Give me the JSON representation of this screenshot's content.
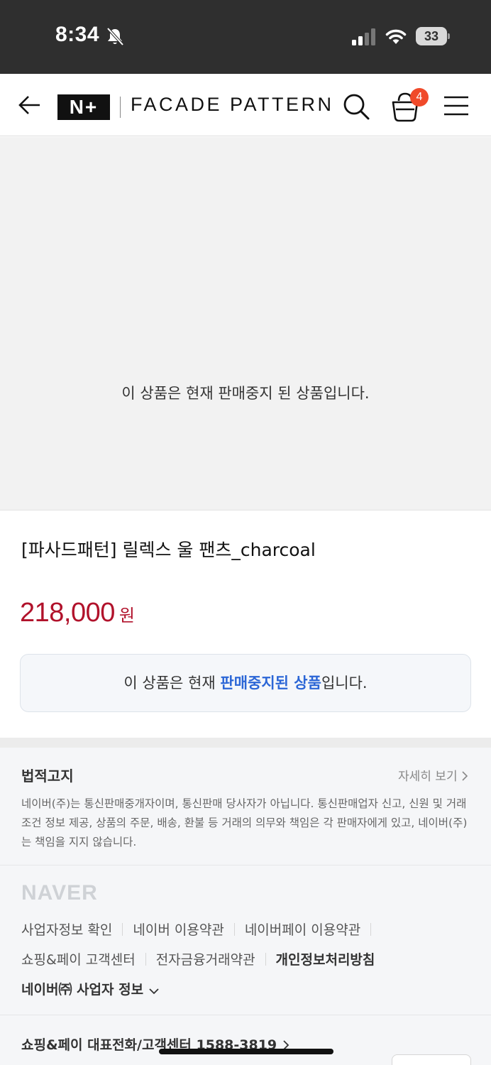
{
  "status_bar": {
    "time": "8:34",
    "battery": "33"
  },
  "header": {
    "logo_text": "N+",
    "brand": "FACADE PATTERN",
    "cart_count": "4"
  },
  "image_area": {
    "message": "이 상품은 현재 판매중지 된 상품입니다."
  },
  "product": {
    "title": "[파사드패턴] 릴렉스 울 팬츠_charcoal",
    "price": "218,000",
    "price_unit": "원",
    "status_prefix": "이 상품은 현재 ",
    "status_highlight": "판매중지된 상품",
    "status_suffix": "입니다."
  },
  "footer": {
    "legal_title": "법적고지",
    "legal_more": "자세히 보기",
    "legal_text": "네이버(주)는 통신판매중개자이며, 통신판매 당사자가 아닙니다. 통신판매업자 신고, 신원 및 거래 조건 정보 제공, 상품의 주문, 배송, 환불 등 거래의 의무와 책임은 각 판매자에게 있고, 네이버(주)는 책임을 지지 않습니다.",
    "naver_logo": "NAVER",
    "links_row1": [
      "사업자정보 확인",
      "네이버 이용약관",
      "네이버페이 이용약관"
    ],
    "links_row2": [
      "쇼핑&페이 고객센터",
      "전자금융거래약관",
      "개인정보처리방침"
    ],
    "company_info": "네이버㈜ 사업자 정보",
    "phone_line": "쇼핑&페이 대표전화/고객센터 1588-3819"
  }
}
